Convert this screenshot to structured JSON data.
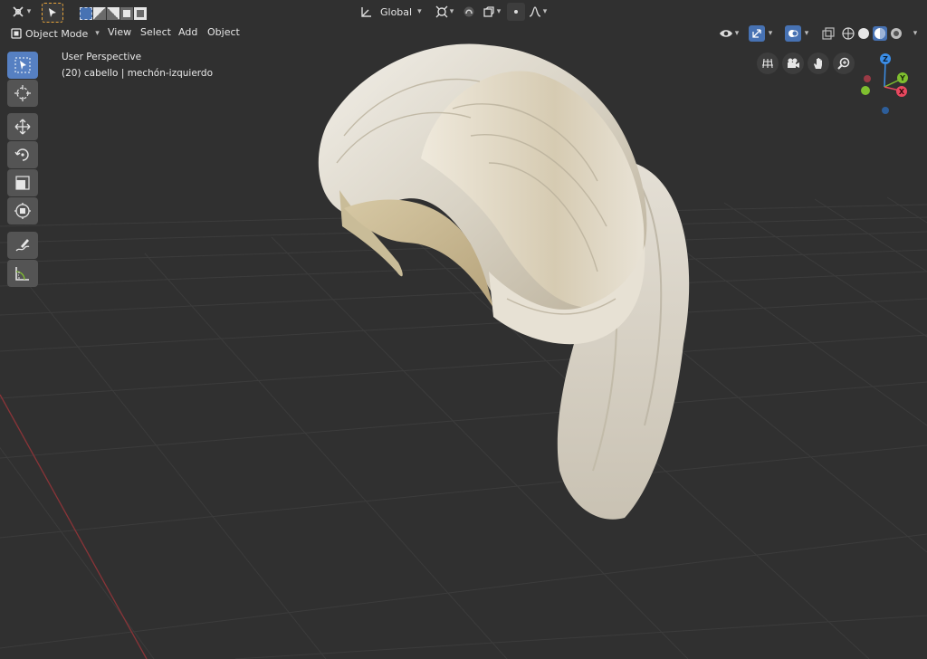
{
  "header": {
    "orientation_label": "Global",
    "mode_label": "Object Mode",
    "menus": [
      "View",
      "Select",
      "Add",
      "Object"
    ]
  },
  "overlay": {
    "view_name": "User Perspective",
    "object_info": "(20) cabello | mechón-izquierdo"
  },
  "gizmo": {
    "z": "Z",
    "y": "Y",
    "x": "X"
  },
  "colors": {
    "viewport_bg": "#303030",
    "active_tool": "#5680c2",
    "tool_bg": "#545454",
    "x_axis": "#e8485f",
    "y_axis": "#7fbf2f",
    "z_axis": "#3b8ee8",
    "mesh": "#d9d2c3"
  },
  "icons": [
    "transform-pivot-icon",
    "select-box-icon",
    "select-mode-icons",
    "orientation-icon",
    "snap-icon",
    "proportional-editing-icon",
    "visibility-icon",
    "gizmo-icon",
    "overlay-icon",
    "xray-icon",
    "shading-icons"
  ]
}
